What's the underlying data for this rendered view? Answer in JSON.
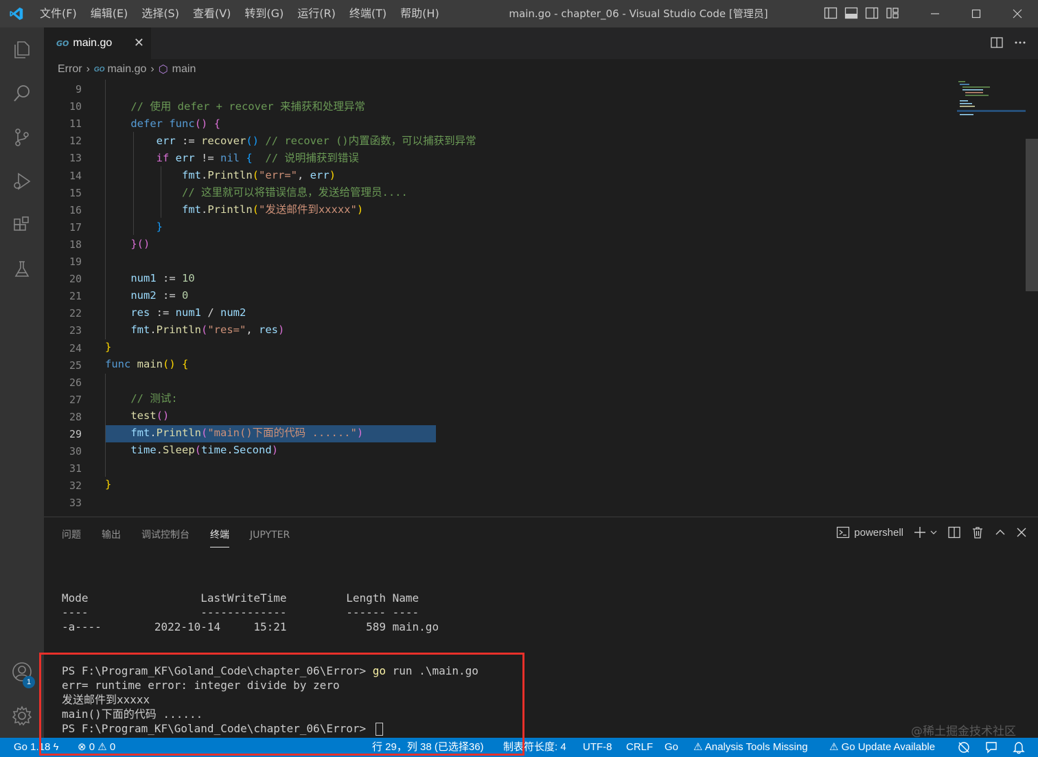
{
  "titlebar": {
    "menu": [
      "文件(F)",
      "编辑(E)",
      "选择(S)",
      "查看(V)",
      "转到(G)",
      "运行(R)",
      "终端(T)",
      "帮助(H)"
    ],
    "window_title": "main.go - chapter_06 - Visual Studio Code [管理员]"
  },
  "activity_bar": {
    "accounts_badge": "1"
  },
  "tab": {
    "icon_text": "GO",
    "label": "main.go"
  },
  "breadcrumb": {
    "folder": "Error",
    "file": "main.go",
    "symbol": "main"
  },
  "editor": {
    "line_numbers": [
      "9",
      "10",
      "11",
      "12",
      "13",
      "14",
      "15",
      "16",
      "17",
      "18",
      "19",
      "20",
      "21",
      "22",
      "23",
      "24",
      "25",
      "26",
      "27",
      "28",
      "29",
      "30",
      "31",
      "32",
      "33"
    ],
    "active_line": "29"
  },
  "panel": {
    "tabs": [
      "问题",
      "输出",
      "调试控制台",
      "终端",
      "JUPYTER"
    ],
    "active_tab": "终端",
    "shell": "powershell",
    "terminal_lines": [
      "Mode                 LastWriteTime         Length Name",
      "----                 -------------         ------ ----",
      "-a----        2022-10-14     15:21            589 main.go",
      "",
      "PS F:\\Program_KF\\Goland_Code\\chapter_06\\Error>",
      "err= runtime error: integer divide by zero",
      "发送邮件到xxxxx",
      "main()下面的代码 ......",
      "PS F:\\Program_KF\\Goland_Code\\chapter_06\\Error>"
    ],
    "command": "go",
    "command_args": " run .\\main.go"
  },
  "watermark": "@稀土掘金技术社区",
  "statusbar": {
    "go_version": "Go 1.18",
    "errors": "0",
    "warnings": "0",
    "cursor_position": "行 29，列 38 (已选择36)",
    "tab_size": "制表符长度: 4",
    "encoding": "UTF-8",
    "eol": "CRLF",
    "language": "Go",
    "analysis_tools": "Analysis Tools Missing",
    "go_update": "Go Update Available"
  },
  "colors": {
    "statusbar": "#007acc",
    "activity_bar": "#333333",
    "editor_bg": "#1e1e1e",
    "highlight_box": "#e8302a"
  }
}
